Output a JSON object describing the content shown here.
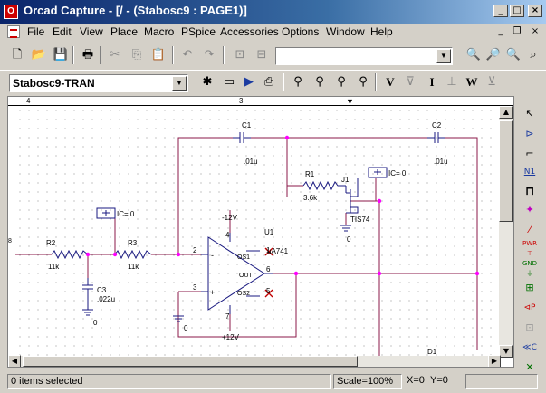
{
  "window": {
    "title": "Orcad Capture - [/ - (Stabosc9 : PAGE1)]",
    "app_icon": "orcad-icon",
    "buttons": [
      "minimize-icon",
      "maximize-icon",
      "close-icon"
    ]
  },
  "menu": {
    "items": [
      "File",
      "Edit",
      "View",
      "Place",
      "Macro",
      "PSpice",
      "Accessories",
      "Options",
      "Window",
      "Help"
    ]
  },
  "toolbar": {
    "search_value": "",
    "profile_value": "Stabosc9-TRAN",
    "letter_buttons": [
      "V",
      "I",
      "W"
    ]
  },
  "ruler": {
    "marks": [
      "4",
      "3"
    ]
  },
  "schematic": {
    "colors": {
      "wire": "#8b1a4a",
      "part": "#1a1a80",
      "label": "#000000",
      "junction": "#ff00ff",
      "pin": "#c00000"
    },
    "labels": {
      "c1": "C1",
      "c1_val": ".01u",
      "c2": "C2",
      "c2_val": ".01u",
      "r1": "R1",
      "r1_val": "3.6k",
      "j1": "J1",
      "j1_model": "TIS74",
      "ic_top": "IC= 0",
      "ic_left": "IC= 0",
      "r2": "R2",
      "r2_val": "11k",
      "r3": "R3",
      "r3_val": "11k",
      "c3": "C3",
      "c3_val": ".022u",
      "u1": "U1",
      "u1_model": "uA741",
      "vneg": "-12V",
      "vpos": "+12V",
      "pin4": "4",
      "pin7": "7",
      "pin2": "2",
      "pin3": "3",
      "pin6": "6",
      "pin1": "1",
      "pin5": "5",
      "os1": "OS1",
      "os2": "OS2",
      "out": "OUT",
      "minus": "-",
      "plus": "+",
      "gnd1": "0",
      "gnd2": "0",
      "gnd3": "0",
      "d1": "D1",
      "port_marker": "8"
    }
  },
  "palette": {
    "items": [
      "select-icon",
      "place-part-icon",
      "wire-icon",
      "net-alias-icon",
      "bus-icon",
      "junction-icon",
      "bus-entry-icon",
      "power-icon",
      "ground-icon",
      "hierarchical-block-icon",
      "hierarchical-port-icon",
      "hierarchical-pin-icon",
      "off-page-connector-icon",
      "no-connect-icon"
    ],
    "labels": {
      "n1": "N1",
      "pwr": "PWR",
      "gnd": "GND",
      "p": "P",
      "c": "C"
    }
  },
  "status": {
    "selection": "0 items selected",
    "scale": "Scale=100%",
    "x": "X=0",
    "y": "Y=0"
  }
}
